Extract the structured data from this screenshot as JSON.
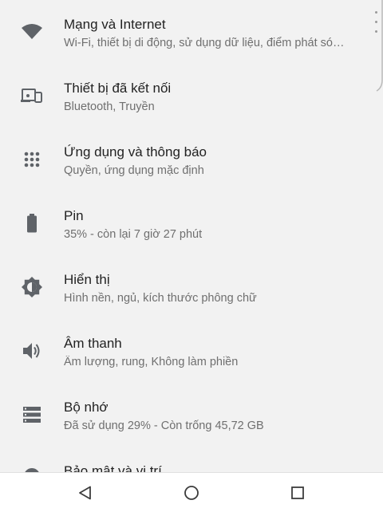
{
  "settings": {
    "items": [
      {
        "icon": "wifi-icon",
        "title": "Mạng và Internet",
        "subtitle": "Wi-Fi, thiết bị di động, sử dụng dữ liệu, điểm phát só…"
      },
      {
        "icon": "connected-devices-icon",
        "title": "Thiết bị đã kết nối",
        "subtitle": "Bluetooth, Truyền"
      },
      {
        "icon": "apps-grid-icon",
        "title": "Ứng dụng và thông báo",
        "subtitle": "Quyền, ứng dụng mặc định"
      },
      {
        "icon": "battery-icon",
        "title": "Pin",
        "subtitle": "35% - còn lại 7 giờ 27 phút"
      },
      {
        "icon": "brightness-icon",
        "title": "Hiển thị",
        "subtitle": "Hình nền, ngủ, kích thước phông chữ"
      },
      {
        "icon": "volume-icon",
        "title": "Âm thanh",
        "subtitle": "Âm lượng, rung, Không làm phiền"
      },
      {
        "icon": "storage-icon",
        "title": "Bộ nhớ",
        "subtitle": "Đã sử dụng 29% - Còn trống 45,72 GB"
      },
      {
        "icon": "location-icon",
        "title": "Bảo mật và vị trí",
        "subtitle": ""
      }
    ]
  },
  "nav_bar": {
    "back": "back-icon",
    "home": "home-icon",
    "recents": "recents-icon"
  },
  "colors": {
    "background": "#f2f2f2",
    "title_text": "#222222",
    "subtitle_text": "#6f6f6f",
    "icon": "#5f6368",
    "nav_bar_bg": "#ffffff"
  }
}
